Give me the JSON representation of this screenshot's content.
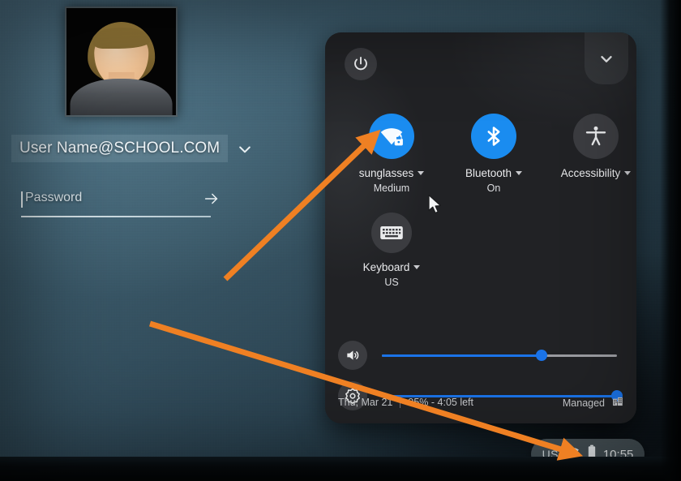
{
  "login": {
    "avatar_alt": "default-user-avatar",
    "username": "User Name@SCHOOL.COM",
    "username_dropdown_icon": "chevron-down-icon",
    "password_placeholder": "Password",
    "password_value": "",
    "submit_icon": "arrow-right-icon"
  },
  "quick_settings": {
    "power_icon": "power-icon",
    "collapse_icon": "chevron-down-icon",
    "tiles": [
      {
        "name": "network",
        "icon": "wifi-locked-icon",
        "label": "sunglasses",
        "sublabel": "Medium",
        "state": "on",
        "has_dropdown": true
      },
      {
        "name": "bluetooth",
        "icon": "bluetooth-icon",
        "label": "Bluetooth",
        "sublabel": "On",
        "state": "on",
        "has_dropdown": true
      },
      {
        "name": "accessibility",
        "icon": "accessibility-person-icon",
        "label": "Accessibility",
        "sublabel": "",
        "state": "off",
        "has_dropdown": true
      },
      {
        "name": "keyboard",
        "icon": "keyboard-icon",
        "label": "Keyboard",
        "sublabel": "US",
        "state": "off",
        "has_dropdown": true
      }
    ],
    "sliders": [
      {
        "name": "volume",
        "icon": "volume-up-icon",
        "percent": 68
      },
      {
        "name": "brightness",
        "icon": "brightness-icon",
        "percent": 100
      }
    ],
    "status": {
      "date": "Thu, Mar 21",
      "battery": "95% - 4:05 left",
      "managed_label": "Managed",
      "managed_icon": "enterprise-building-icon"
    }
  },
  "shelf": {
    "keyboard_indicator": "US",
    "wifi_icon": "wifi-icon",
    "battery_icon": "battery-icon",
    "time": "10:55"
  },
  "annotations": {
    "arrow_1_target": "network-tile",
    "arrow_2_target": "shelf-tray",
    "color": "#ef8023"
  },
  "colors": {
    "accent_blue": "#1a8cf0",
    "slider_blue": "#1a73e8",
    "panel_bg": "#212225",
    "tile_off_bg": "#3b3c40",
    "annotation_orange": "#ef8023"
  }
}
